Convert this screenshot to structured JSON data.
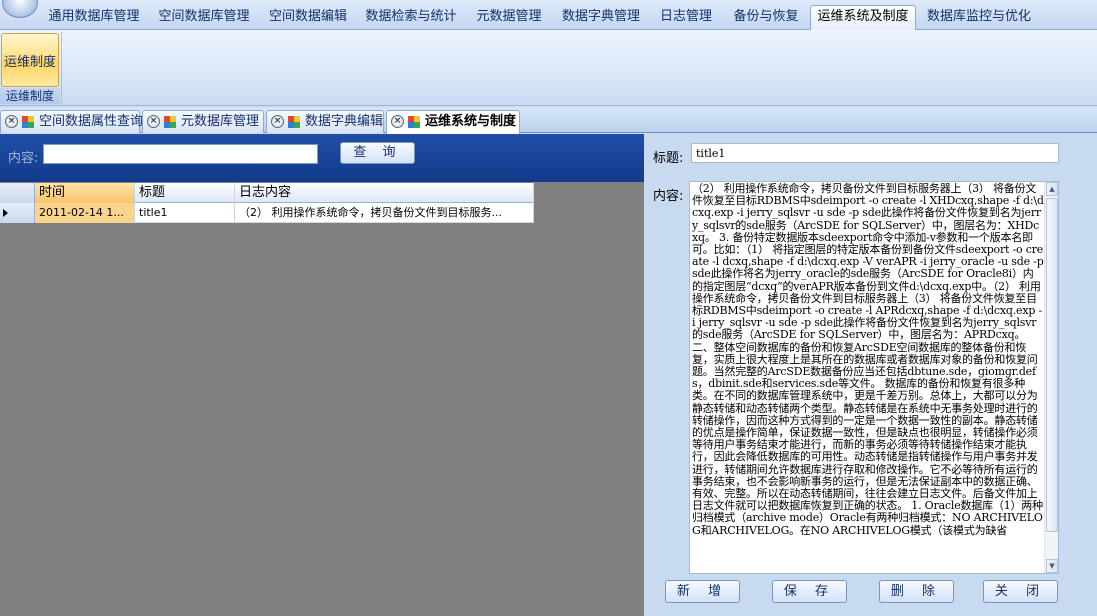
{
  "menu": {
    "tabs": [
      {
        "label": "通用数据库管理"
      },
      {
        "label": "空间数据库管理"
      },
      {
        "label": "空间数据编辑"
      },
      {
        "label": "数据检索与统计"
      },
      {
        "label": "元数据管理"
      },
      {
        "label": "数据字典管理"
      },
      {
        "label": "日志管理"
      },
      {
        "label": "备份与恢复"
      },
      {
        "label": "运维系统及制度"
      },
      {
        "label": "数据库监控与优化"
      }
    ],
    "active_index": 8
  },
  "ribbon": {
    "button_label": "运维制度",
    "group_label": "运维制度"
  },
  "doc_tabs": [
    {
      "label": "空间数据属性查询"
    },
    {
      "label": "元数据库管理"
    },
    {
      "label": "数据字典编辑"
    },
    {
      "label": "运维系统与制度"
    }
  ],
  "search": {
    "label": "内容:",
    "value": "",
    "button_label": "查 询"
  },
  "grid": {
    "headers": {
      "time": "时间",
      "title": "标题",
      "content": "日志内容"
    },
    "rows": [
      {
        "time": "2011-02-14 1...",
        "title": "title1",
        "content": "（2） 利用操作系统命令，拷贝备份文件到目标服务..."
      }
    ]
  },
  "detail": {
    "title_label": "标题:",
    "title_value": "title1",
    "content_label": "内容:",
    "content_value": "（2） 利用操作系统命令，拷贝备份文件到目标服务器上（3） 将备份文件恢复至目标RDBMS中sdeimport -o create -l XHDcxq,shape -f d:\\dcxq.exp -i jerry_sqlsvr -u sde -p sde此操作将备份文件恢复到名为jerry_sqlsvr的sde服务（ArcSDE for SQLServer）中，图层名为：XHDcxq。 3. 备份特定数据版本sdeexport命令中添加-v参数和一个版本名即可。比如：（1） 将指定图层的特定版本备份到备份文件sdeexport -o create -l dcxq,shape -f d:\\dcxq.exp -V verAPR -i jerry_oracle -u sde -p sde此操作将名为jerry_oracle的sde服务（ArcSDE for Oracle8i）内的指定图层“dcxq”的verAPR版本备份到文件d:\\dcxq.exp中。（2） 利用操作系统命令，拷贝备份文件到目标服务器上（3） 将备份文件恢复至目标RDBMS中sdeimport -o create -l APRdcxq,shape -f d:\\dcxq.exp -i jerry_sqlsvr -u sde -p sde此操作将备份文件恢复到名为jerry_sqlsvr的sde服务（ArcSDE for SQLServer）中，图层名为：APRDcxq。 二、整体空间数据库的备份和恢复ArcSDE空间数据库的整体备份和恢复，实质上很大程度上是其所在的数据库或者数据库对象的备份和恢复问题。当然完整的ArcSDE数据备份应当还包括dbtune.sde，giomgr.defs，dbinit.sde和services.sde等文件。 数据库的备份和恢复有很多种类。在不同的数据库管理系统中，更是千差万别。总体上，大都可以分为静态转储和动态转储两个类型。静态转储是在系统中无事务处理时进行的转储操作，因而这种方式得到的一定是一个数据一致性的副本。静态转储的优点是操作简单，保证数据一致性，但是缺点也很明显，转储操作必须等待用户事务结束才能进行，而新的事务必须等待转储操作结束才能执行，因此会降低数据库的可用性。动态转储是指转储操作与用户事务并发进行，转储期间允许数据库进行存取和修改操作。它不必等待所有运行的事务结束，也不会影响新事务的运行，但是无法保证副本中的数据正确、有效、完整。所以在动态转储期间，往往会建立日志文件。后备文件加上日志文件就可以把数据库恢复到正确的状态。 1. Oracle数据库（1）两种归档模式（archive mode）Oracle有两种归档模式：NO ARCHIVELOG和ARCHIVELOG。在NO ARCHIVELOG模式（该模式为缺省"
  },
  "actions": {
    "new_label": "新 增",
    "save_label": "保 存",
    "delete_label": "删 除",
    "close_label": "关 闭"
  }
}
